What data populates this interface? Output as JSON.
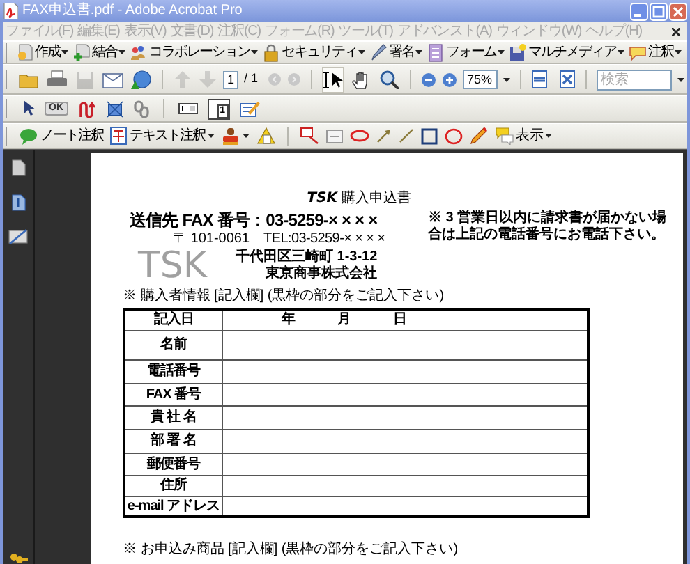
{
  "window": {
    "title": "FAX申込書.pdf - Adobe Acrobat Pro"
  },
  "menu_bar": [
    {
      "label": "ファイル(F)",
      "disabled": true
    },
    {
      "label": "編集(E)",
      "disabled": true
    },
    {
      "label": "表示(V)",
      "disabled": true
    },
    {
      "label": "文書(D)",
      "disabled": true
    },
    {
      "label": "注釈(C)",
      "disabled": true
    },
    {
      "label": "フォーム(R)",
      "disabled": true
    },
    {
      "label": "ツール(T)",
      "disabled": true
    },
    {
      "label": "アドバンスト(A)",
      "disabled": true
    },
    {
      "label": "ウィンドウ(W)",
      "disabled": true
    },
    {
      "label": "ヘルプ(H)",
      "disabled": true
    }
  ],
  "task_toolbar": [
    {
      "label": "作成"
    },
    {
      "label": "結合"
    },
    {
      "label": "コラボレーション"
    },
    {
      "label": "セキュリティ"
    },
    {
      "label": "署名"
    },
    {
      "label": "フォーム"
    },
    {
      "label": "マルチメディア"
    },
    {
      "label": "注釈"
    }
  ],
  "file_toolbar": {
    "buttons": [
      {
        "kind": "open",
        "disabled": false
      },
      {
        "kind": "print",
        "disabled": false
      },
      {
        "kind": "save",
        "disabled": true
      },
      {
        "kind": "email",
        "disabled": false
      },
      {
        "kind": "upload",
        "disabled": false
      }
    ],
    "page_buttons": [
      {
        "kind": "previous",
        "disabled": true
      },
      {
        "kind": "next",
        "disabled": true
      }
    ],
    "page_number": "1",
    "page_count": "/ 1",
    "tools": [
      {
        "kind": "select",
        "selected": true
      },
      {
        "kind": "hand",
        "selected": false
      },
      {
        "kind": "zoom",
        "selected": false
      }
    ],
    "zoom": "75%",
    "search": {
      "placeholder": "検索"
    }
  },
  "forms_toolbar": {
    "button_tool_label": "OK",
    "numbered_field_label": "1"
  },
  "comment_toolbar": {
    "note_label": "ノート注釈",
    "text_edit_label": "テキスト注釈",
    "show_label": "表示"
  },
  "document": {
    "title": "**TSK** 購入申込書",
    "fax_line": "送信先 FAX 番号：03-5259-× × × ×",
    "note": "※ 3 営業日以内に請求書が届かない場合は上記の電話番号にお電話下さい。",
    "postal_code": "〒 101-0061",
    "phone": "TEL:03-5259-× × × ×",
    "address": "千代田区三崎町 1-3-12",
    "company": "東京商事株式会社",
    "logo": "TSK",
    "buyer_section": "※ 購入者情報 [記入欄] (黒枠の部分をご記入下さい)",
    "buyer_table": [
      {
        "label": "記入日",
        "value": "年　　　月　　　日"
      },
      {
        "label": "名前"
      },
      {
        "label": "電話番号"
      },
      {
        "label": "FAX 番号"
      },
      {
        "label": "貴 社 名"
      },
      {
        "label": "部 署 名"
      },
      {
        "label": "郵便番号"
      },
      {
        "label": "住所"
      },
      {
        "label": "e-mail アドレス"
      }
    ],
    "product_section": "※ お申込み商品 [記入欄] (黒枠の部分をご記入下さい)"
  }
}
